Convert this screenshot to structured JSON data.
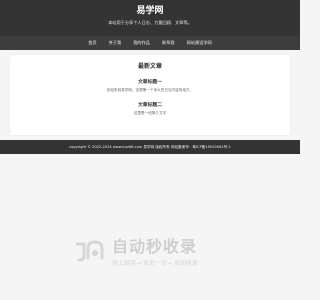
{
  "header": {
    "site_title": "易学网",
    "site_desc": "本站用于分享个人日志、力量回顾、文章等。"
  },
  "nav": {
    "items": [
      {
        "label": "首页"
      },
      {
        "label": "关于我"
      },
      {
        "label": "我的作品"
      },
      {
        "label": "联系我"
      },
      {
        "label": "网站建设学网"
      }
    ]
  },
  "main": {
    "section_title": "最新文章",
    "posts": [
      {
        "title": "文章标题一",
        "excerpt": "欢迎来到易学网，这是第一个伟大的日志内容的地方。"
      },
      {
        "title": "文章标题二",
        "excerpt": "这里是一段简介文字"
      }
    ]
  },
  "footer": {
    "copyright": "copyright © 2022-2024 www.buz66.com 易学网 版权所有 网站备案号：",
    "icp": "粤ICP备19020061号-1"
  },
  "watermark": {
    "title": "自动秒收录",
    "slogan": "放上链接→ 本页一次→ 自动收录"
  }
}
